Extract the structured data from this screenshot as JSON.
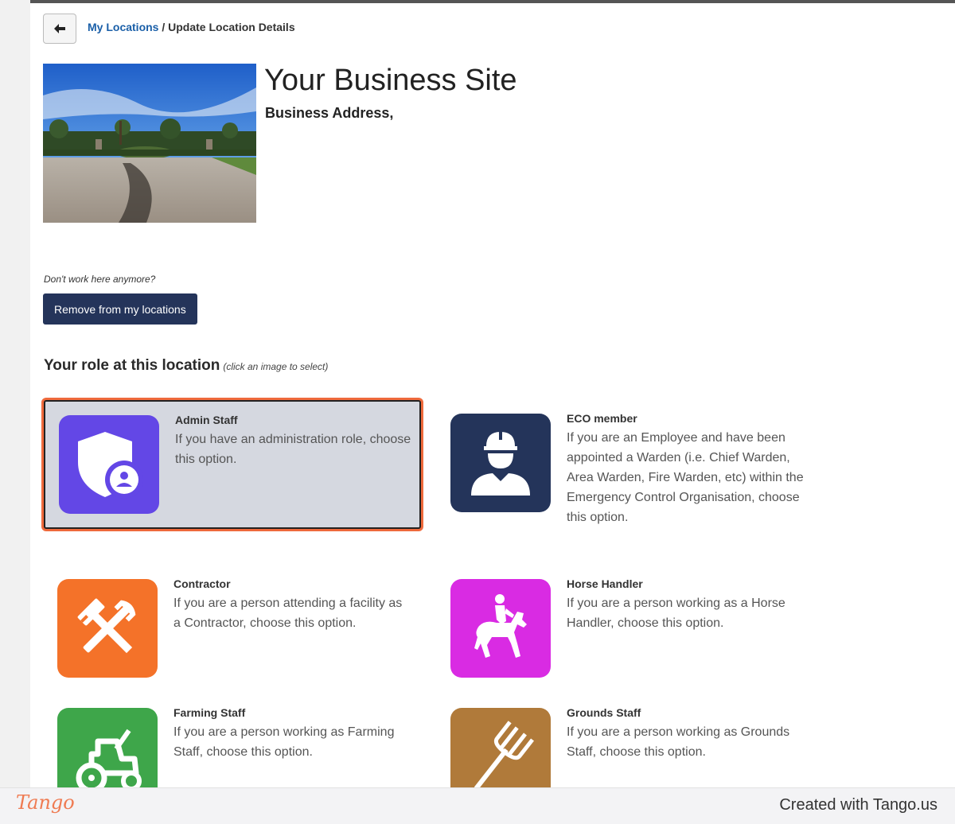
{
  "breadcrumb": {
    "link": "My Locations",
    "separator": " / ",
    "current": "Update Location Details"
  },
  "site": {
    "title": "Your Business Site",
    "address": "Business Address,"
  },
  "leave": {
    "note": "Don't work here anymore?",
    "button": "Remove from my locations"
  },
  "roles_section": {
    "heading": "Your role at this location",
    "hint": "(click an image to select)"
  },
  "roles": [
    {
      "name": "Admin Staff",
      "desc": "If you have an administration role, choose this option.",
      "icon": "shield-user-icon",
      "color": "#6347e6",
      "selected": true
    },
    {
      "name": "ECO member",
      "desc": "If you are an Employee and have been appointed a Warden (i.e. Chief Warden, Area Warden, Fire Warden, etc) within the Emergency Control Organisation, choose this option.",
      "icon": "hardhat-worker-icon",
      "color": "#24345a",
      "selected": false
    },
    {
      "name": "Contractor",
      "desc": "If you are a person attending a facility as a Contractor, choose this option.",
      "icon": "tools-icon",
      "color": "#f47229",
      "selected": false
    },
    {
      "name": "Horse Handler",
      "desc": "If you are a person working as a Horse Handler, choose this option.",
      "icon": "horse-rider-icon",
      "color": "#d92be3",
      "selected": false
    },
    {
      "name": "Farming Staff",
      "desc": "If you are a person working as Farming Staff, choose this option.",
      "icon": "tractor-icon",
      "color": "#3ea64a",
      "selected": false
    },
    {
      "name": "Grounds Staff",
      "desc": "If you are a person working as Grounds Staff, choose this option.",
      "icon": "pitchfork-icon",
      "color": "#b07a3a",
      "selected": false
    }
  ],
  "footer": {
    "logo": "Tango",
    "credit": "Created with Tango.us"
  }
}
